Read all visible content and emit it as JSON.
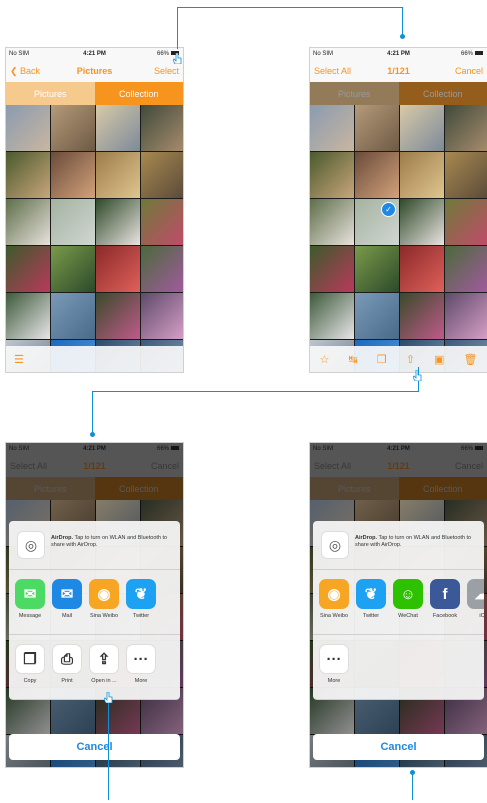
{
  "status": {
    "carrier": "No SIM",
    "time": "4:21 PM",
    "battery": "66%"
  },
  "screen1": {
    "nav": {
      "back": "Back",
      "title": "Pictures",
      "right": "Select"
    },
    "segments": [
      "Pictures",
      "Collection"
    ]
  },
  "screen2": {
    "nav": {
      "left": "Select All",
      "title": "1/121",
      "right": "Cancel"
    },
    "segments": [
      "Pictures",
      "Collection"
    ]
  },
  "screen3": {
    "nav": {
      "left": "Select All",
      "title": "1/121",
      "right": "Cancel"
    },
    "segments": [
      "Pictures",
      "Collection"
    ],
    "airdrop": {
      "bold": "AirDrop.",
      "text": "Tap to turn on WLAN and Bluetooth to share with AirDrop."
    },
    "apps": [
      {
        "label": "Message",
        "icon": "message-icon",
        "color": "#4cd964"
      },
      {
        "label": "Mail",
        "icon": "mail-icon",
        "color": "#1e88e5"
      },
      {
        "label": "Sina Weibo",
        "icon": "weibo-icon",
        "color": "#f6a623"
      },
      {
        "label": "Twitter",
        "icon": "twitter-icon",
        "color": "#1da1f2"
      }
    ],
    "actions": [
      {
        "label": "Copy",
        "icon": "copy-icon"
      },
      {
        "label": "Print",
        "icon": "print-icon"
      },
      {
        "label": "Open in ...",
        "icon": "open-in-icon"
      },
      {
        "label": "More",
        "icon": "more-icon"
      }
    ],
    "cancel": "Cancel"
  },
  "screen4": {
    "nav": {
      "left": "Select All",
      "title": "1/121",
      "right": "Cancel"
    },
    "segments": [
      "Pictures",
      "Collection"
    ],
    "airdrop": {
      "bold": "AirDrop.",
      "text": "Tap to turn on WLAN and Bluetooth to share with AirDrop."
    },
    "apps": [
      {
        "label": "Sina Weibo",
        "icon": "weibo-icon",
        "color": "#f6a623"
      },
      {
        "label": "Twitter",
        "icon": "twitter-icon",
        "color": "#1da1f2"
      },
      {
        "label": "WeChat",
        "icon": "wechat-icon",
        "color": "#2dc100"
      },
      {
        "label": "Facebook",
        "icon": "facebook-icon",
        "color": "#3b5998"
      },
      {
        "label": "iC",
        "icon": "icloud-icon",
        "color": "#9aa0a6"
      }
    ],
    "actions": [
      {
        "label": "More",
        "icon": "more-icon"
      }
    ],
    "cancel": "Cancel"
  },
  "colors": {
    "accent": "#f7941d",
    "link": "#1e88e5",
    "callout": "#0e8fd6"
  }
}
